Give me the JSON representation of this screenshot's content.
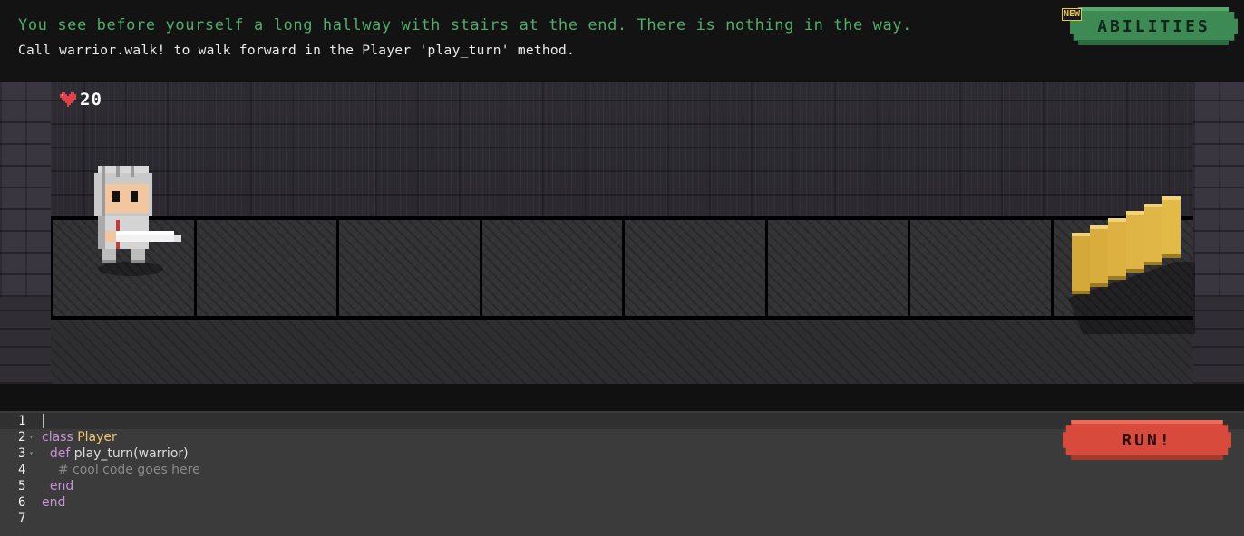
{
  "header": {
    "story": "You see before yourself a long hallway with stairs at the end. There is nothing in the way.",
    "tip": "Call warrior.walk! to walk forward in the Player 'play_turn' method.",
    "abilities_label": "ABILITIES",
    "new_badge": "NEW"
  },
  "game": {
    "health_icon": "heart-icon",
    "health": "20",
    "tile_count": 8,
    "warrior_tile": 1,
    "stairs_tile": 8
  },
  "editor": {
    "line_numbers": [
      "1",
      "2",
      "3",
      "4",
      "5",
      "6",
      "7"
    ],
    "lines": [
      {
        "indent": "",
        "parts": []
      },
      {
        "indent": "",
        "parts": [
          {
            "t": "class",
            "c": "kw"
          },
          {
            "t": " ",
            "c": ""
          },
          {
            "t": "Player",
            "c": "cls"
          }
        ]
      },
      {
        "indent": "  ",
        "parts": [
          {
            "t": "def",
            "c": "kw"
          },
          {
            "t": " play_turn(warrior)",
            "c": ""
          }
        ]
      },
      {
        "indent": "    ",
        "parts": [
          {
            "t": "# cool code goes here",
            "c": "comment"
          }
        ]
      },
      {
        "indent": "  ",
        "parts": [
          {
            "t": "end",
            "c": "kw"
          }
        ]
      },
      {
        "indent": "",
        "parts": [
          {
            "t": "end",
            "c": "kw"
          }
        ]
      },
      {
        "indent": "",
        "parts": []
      }
    ],
    "run_label": "RUN!"
  },
  "colors": {
    "story_text": "#4fae6a",
    "abilities_button": "#3e8a55",
    "run_button": "#d84a3b",
    "keyword": "#c792d8",
    "class_name": "#f2c76e",
    "comment": "#888888"
  }
}
